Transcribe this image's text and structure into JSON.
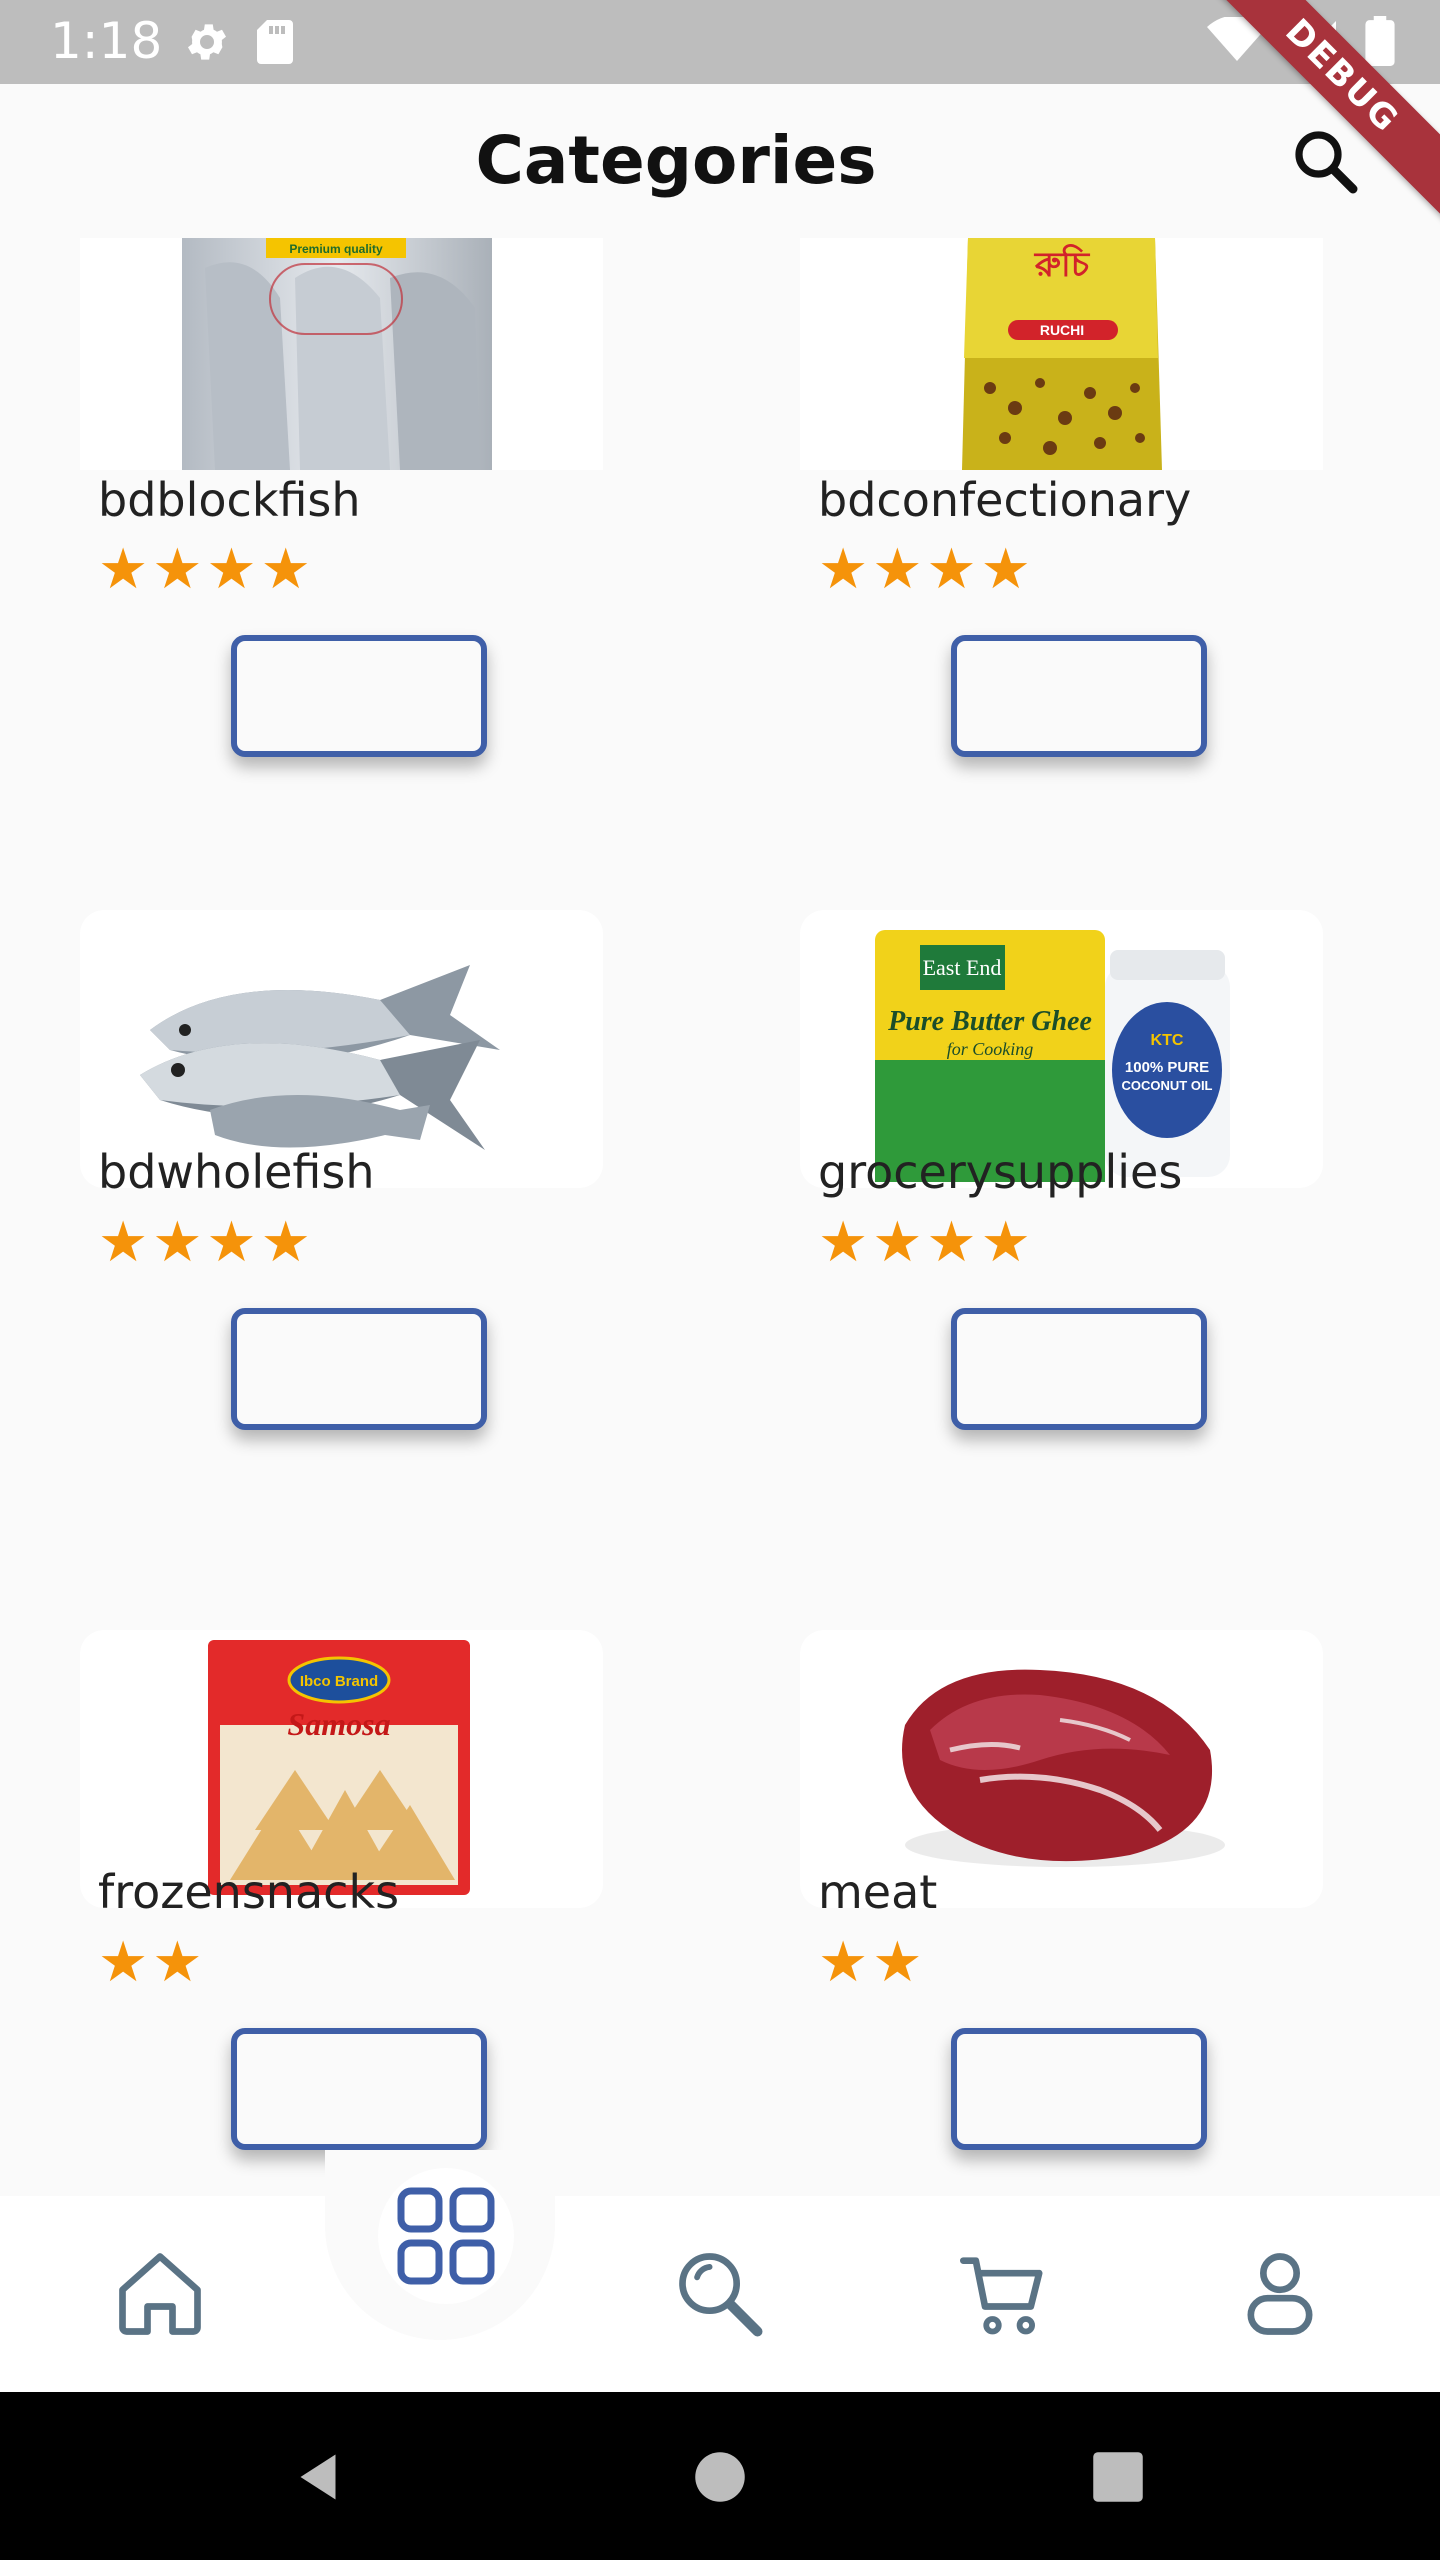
{
  "status_bar": {
    "time": "1:18",
    "icons": [
      "settings-icon",
      "sd-card-icon",
      "wifi-icon",
      "signal-icon",
      "battery-icon"
    ]
  },
  "debug_banner": {
    "label": "DEBUG"
  },
  "app_bar": {
    "title": "Categories",
    "search_icon": "search-icon"
  },
  "categories": [
    {
      "name": "bdblockfish",
      "rating": 4,
      "stars": "★★★★",
      "image": "frozen-fish-pack"
    },
    {
      "name": "bdconfectionary",
      "rating": 4,
      "stars": "★★★★",
      "image": "chanachur-pack"
    },
    {
      "name": "bdwholefish",
      "rating": 4,
      "stars": "★★★★",
      "image": "whole-fish"
    },
    {
      "name": "grocerysupplies",
      "rating": 4,
      "stars": "★★★★",
      "image": "ghee-and-coconut-oil"
    },
    {
      "name": "frozensnacks",
      "rating": 2,
      "stars": "★★",
      "image": "samosa-pack"
    },
    {
      "name": "meat",
      "rating": 2,
      "stars": "★★",
      "image": "raw-meat"
    }
  ],
  "image_text": {
    "fish_pack_label": "Premium quality",
    "chanachur_brand": "RUCHI",
    "chanachur_bengali": "রুচি",
    "ghee_brand": "East End",
    "ghee_name": "Pure Butter Ghee",
    "ghee_sub": "for Cooking",
    "oil_brand": "KTC",
    "oil_name_1": "100% PURE",
    "oil_name_2": "COCONUT OIL",
    "samosa_brand": "Ibco Brand",
    "samosa_name": "Samosa"
  },
  "bottom_nav": {
    "items": [
      "home-icon",
      "categories-icon",
      "search-icon",
      "cart-icon",
      "profile-icon"
    ],
    "active": "categories-icon"
  },
  "colors": {
    "accent": "#3f5fa8",
    "star": "#f5930a",
    "nav_icon": "#5a7385",
    "status_bar": "#bdbdbd",
    "debug_ribbon": "#a8333c"
  }
}
